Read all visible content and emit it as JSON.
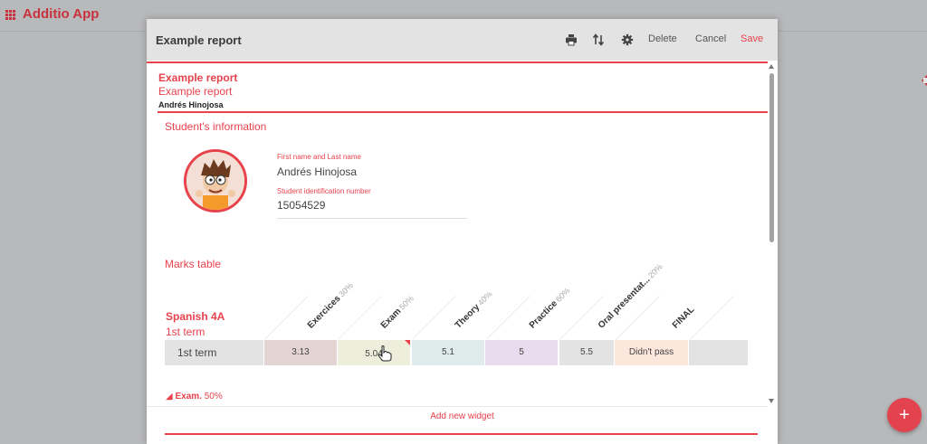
{
  "app": {
    "name": "Additio App"
  },
  "fab": {
    "label": "+"
  },
  "modal": {
    "title": "Example report",
    "actions": {
      "delete": "Delete",
      "cancel": "Cancel",
      "save": "Save"
    },
    "icons": [
      "print-icon",
      "sort-icon",
      "gear-icon"
    ]
  },
  "report": {
    "title": "Example report",
    "subtitle": "Example report",
    "student_name": "Andrés Hinojosa"
  },
  "student_info": {
    "heading": "Student's information",
    "name_label": "First name and Last name",
    "name_value": "Andrés Hinojosa",
    "id_label": "Student identification number",
    "id_value": "15054529"
  },
  "marks": {
    "heading": "Marks table",
    "subject": "Spanish 4A",
    "term": "1st term",
    "columns": [
      {
        "name": "Exercices",
        "pct": "30%"
      },
      {
        "name": "Exam",
        "pct": "50%"
      },
      {
        "name": "Theory",
        "pct": "40%"
      },
      {
        "name": "Practice",
        "pct": "60%"
      },
      {
        "name": "Oral presentat...",
        "pct": "20%"
      },
      {
        "name": "FINAL",
        "pct": ""
      }
    ],
    "row": {
      "label": "1st term",
      "cells": [
        "3.13",
        "5.04",
        "5.1",
        "5",
        "5.5",
        "Didn't pass",
        ""
      ]
    },
    "colors": [
      "#e3d3d3",
      "#eeeedd",
      "#dfeaea",
      "#e9dcee",
      "#e3e3e3",
      "#fde7dd",
      "#e3e3e3"
    ],
    "exam_link": {
      "arrow": "◢",
      "name": "Exam.",
      "pct": " 50%"
    }
  },
  "footer": {
    "add_widget": "Add new widget"
  }
}
